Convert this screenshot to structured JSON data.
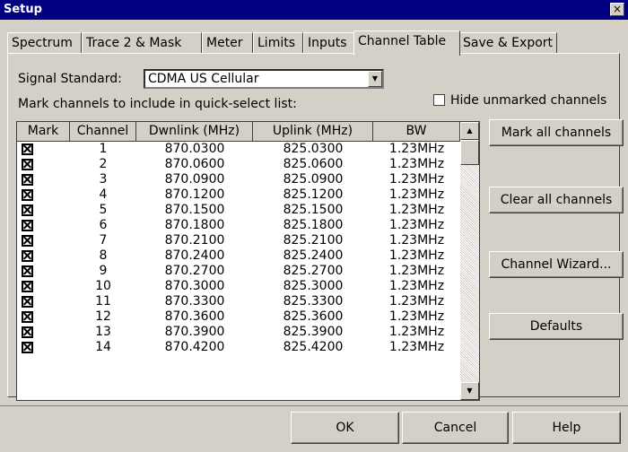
{
  "window": {
    "title": "Setup",
    "close_glyph": "×"
  },
  "tabs": [
    "Spectrum",
    "Trace 2 & Mask",
    "Meter",
    "Limits",
    "Inputs",
    "Channel Table",
    "Save & Export"
  ],
  "active_tab": "Channel Table",
  "signal_standard": {
    "label": "Signal Standard:",
    "value": "CDMA US Cellular"
  },
  "mark_instructions": "Mark channels to include in quick-select list:",
  "hide_unmarked": {
    "label": "Hide unmarked channels",
    "checked": false
  },
  "table": {
    "headers": [
      "Mark",
      "Channel",
      "Dwnlink (MHz)",
      "Uplink (MHz)",
      "BW"
    ],
    "rows": [
      {
        "mark": true,
        "channel": "1",
        "dwnlink": "870.0300",
        "uplink": "825.0300",
        "bw": "1.23MHz"
      },
      {
        "mark": true,
        "channel": "2",
        "dwnlink": "870.0600",
        "uplink": "825.0600",
        "bw": "1.23MHz"
      },
      {
        "mark": true,
        "channel": "3",
        "dwnlink": "870.0900",
        "uplink": "825.0900",
        "bw": "1.23MHz"
      },
      {
        "mark": true,
        "channel": "4",
        "dwnlink": "870.1200",
        "uplink": "825.1200",
        "bw": "1.23MHz"
      },
      {
        "mark": true,
        "channel": "5",
        "dwnlink": "870.1500",
        "uplink": "825.1500",
        "bw": "1.23MHz"
      },
      {
        "mark": true,
        "channel": "6",
        "dwnlink": "870.1800",
        "uplink": "825.1800",
        "bw": "1.23MHz"
      },
      {
        "mark": true,
        "channel": "7",
        "dwnlink": "870.2100",
        "uplink": "825.2100",
        "bw": "1.23MHz"
      },
      {
        "mark": true,
        "channel": "8",
        "dwnlink": "870.2400",
        "uplink": "825.2400",
        "bw": "1.23MHz"
      },
      {
        "mark": true,
        "channel": "9",
        "dwnlink": "870.2700",
        "uplink": "825.2700",
        "bw": "1.23MHz"
      },
      {
        "mark": true,
        "channel": "10",
        "dwnlink": "870.3000",
        "uplink": "825.3000",
        "bw": "1.23MHz"
      },
      {
        "mark": true,
        "channel": "11",
        "dwnlink": "870.3300",
        "uplink": "825.3300",
        "bw": "1.23MHz"
      },
      {
        "mark": true,
        "channel": "12",
        "dwnlink": "870.3600",
        "uplink": "825.3600",
        "bw": "1.23MHz"
      },
      {
        "mark": true,
        "channel": "13",
        "dwnlink": "870.3900",
        "uplink": "825.3900",
        "bw": "1.23MHz"
      },
      {
        "mark": true,
        "channel": "14",
        "dwnlink": "870.4200",
        "uplink": "825.4200",
        "bw": "1.23MHz"
      }
    ]
  },
  "side_buttons": {
    "mark_all": "Mark all channels",
    "clear_all": "Clear all channels",
    "wizard": "Channel Wizard...",
    "defaults": "Defaults"
  },
  "footer_buttons": {
    "ok": "OK",
    "cancel": "Cancel",
    "help": "Help"
  },
  "colors": {
    "titlebar": "#000080",
    "face": "#d4d0c8",
    "window": "#ffffff"
  },
  "icons": [
    "close-icon",
    "dropdown-arrow-icon",
    "scroll-up-icon",
    "scroll-down-icon",
    "checked-box-icon"
  ]
}
